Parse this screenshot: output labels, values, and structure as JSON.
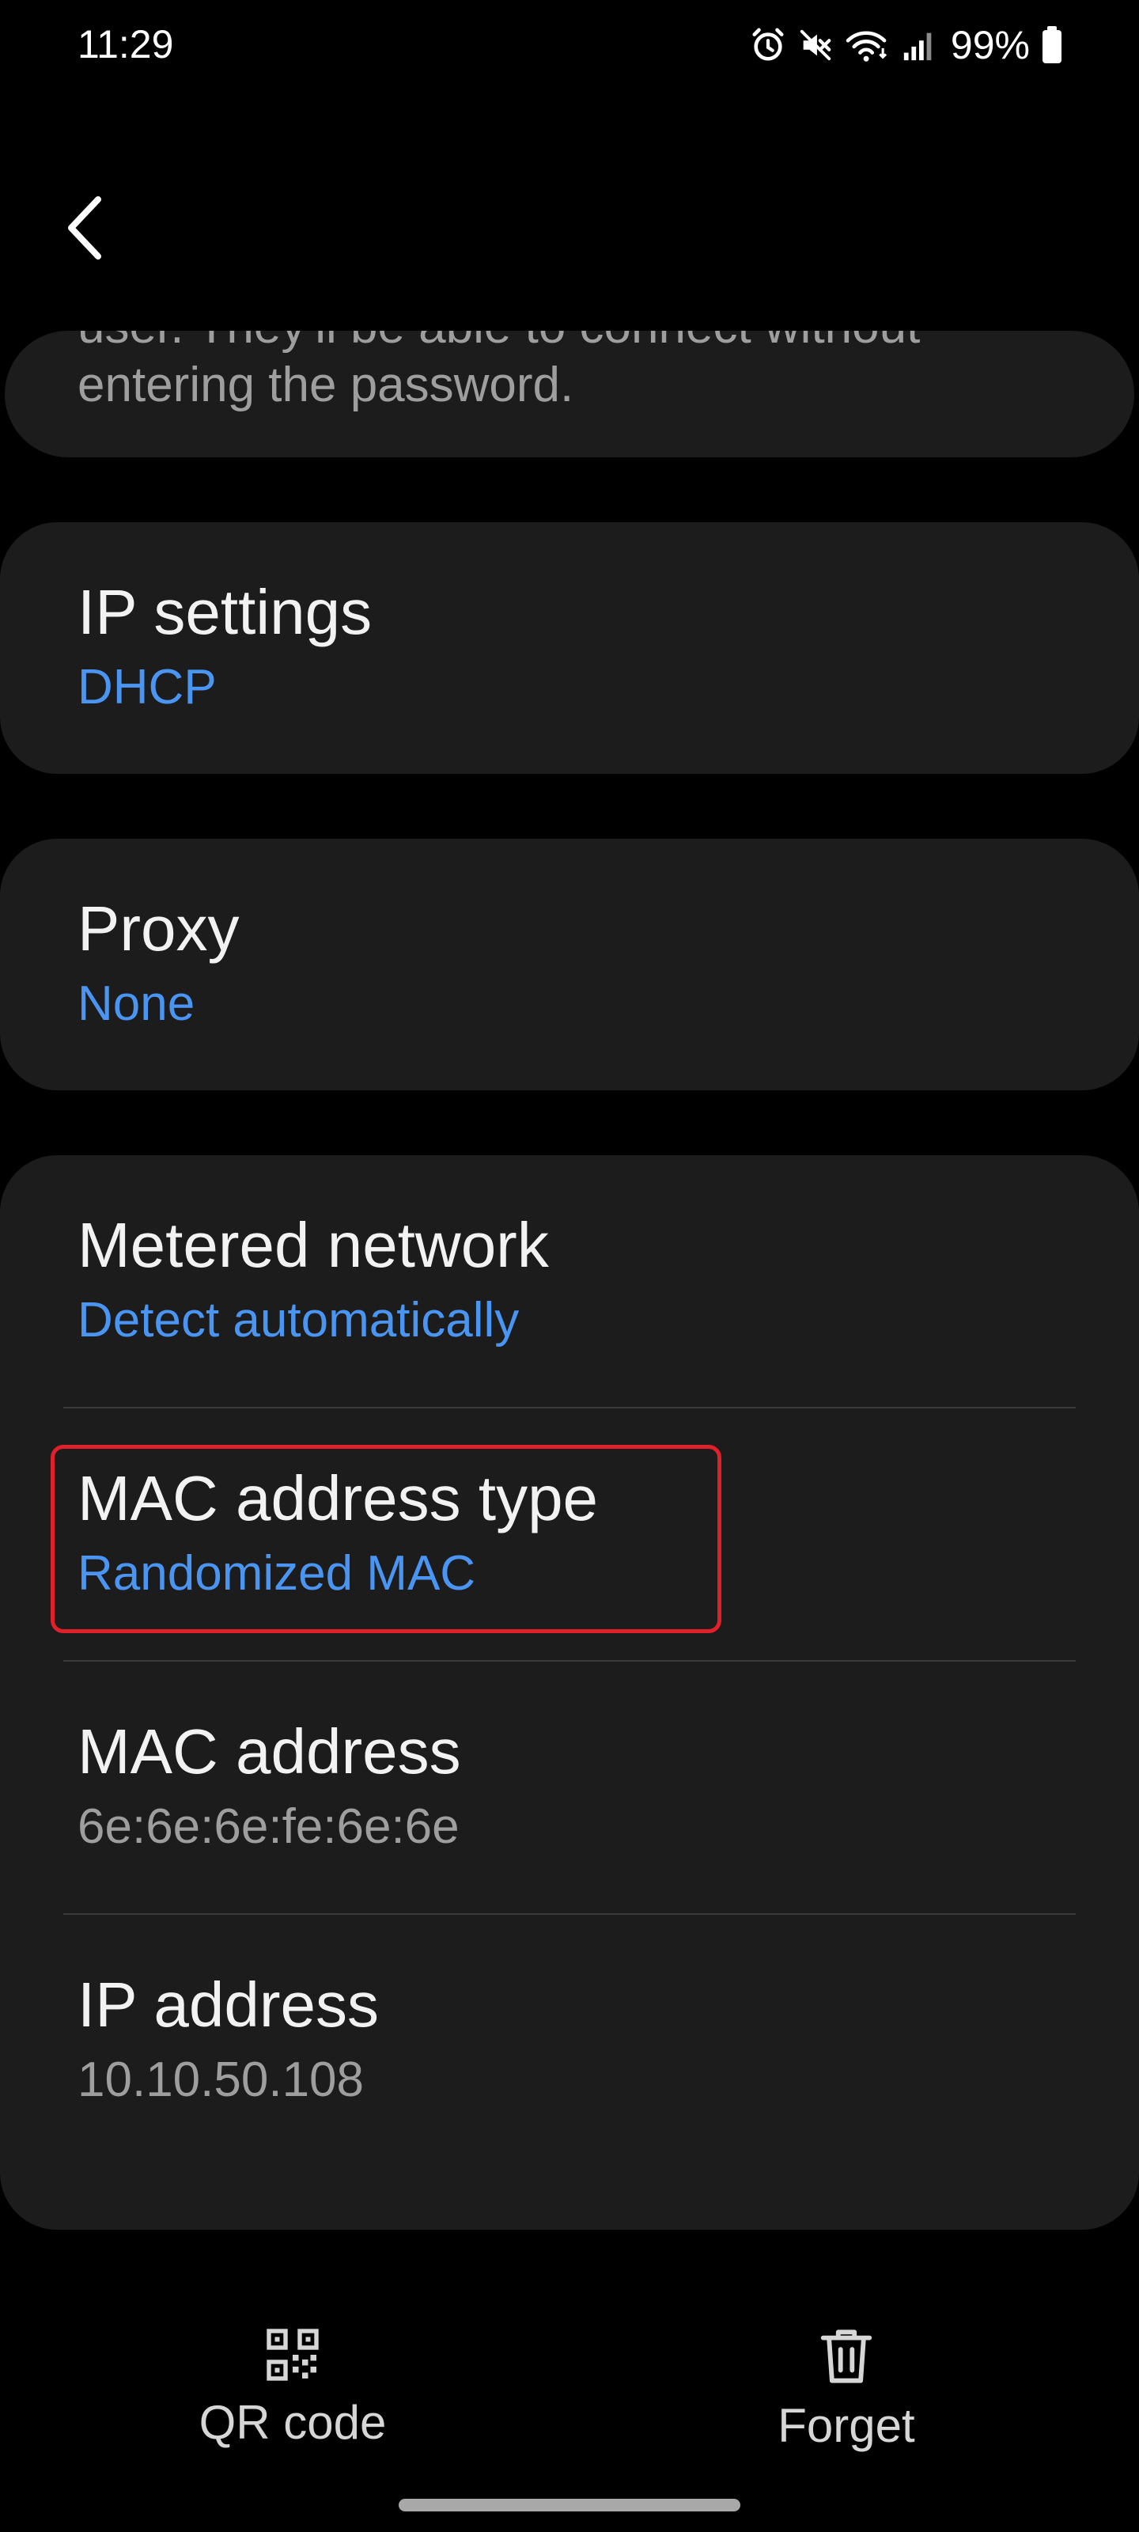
{
  "status_bar": {
    "time": "11:29",
    "battery": "99%",
    "icons": [
      "alarm-icon",
      "mute-icon",
      "wifi-icon",
      "signal-icon",
      "battery-icon"
    ]
  },
  "nav": {
    "back_icon": "chevron-left-icon"
  },
  "partial_card": {
    "line_top": "user. They'll be able to connect without",
    "line_bottom": "entering the password."
  },
  "ip_settings": {
    "title": "IP settings",
    "value": "DHCP"
  },
  "proxy": {
    "title": "Proxy",
    "value": "None"
  },
  "metered_network": {
    "title": "Metered network",
    "value": "Detect automatically"
  },
  "mac_address_type": {
    "title": "MAC address type",
    "value": "Randomized MAC"
  },
  "mac_address": {
    "title": "MAC address",
    "value": "6e:6e:6e:fe:6e:6e"
  },
  "ip_address": {
    "title": "IP address",
    "value": "10.10.50.108"
  },
  "actions": {
    "qr_label": "QR code",
    "forget_label": "Forget"
  },
  "colors": {
    "background": "#000000",
    "card": "#1c1c1c",
    "accent_blue": "#4b95f2",
    "secondary_text": "#9e9e9e",
    "highlight": "#e0202a"
  }
}
